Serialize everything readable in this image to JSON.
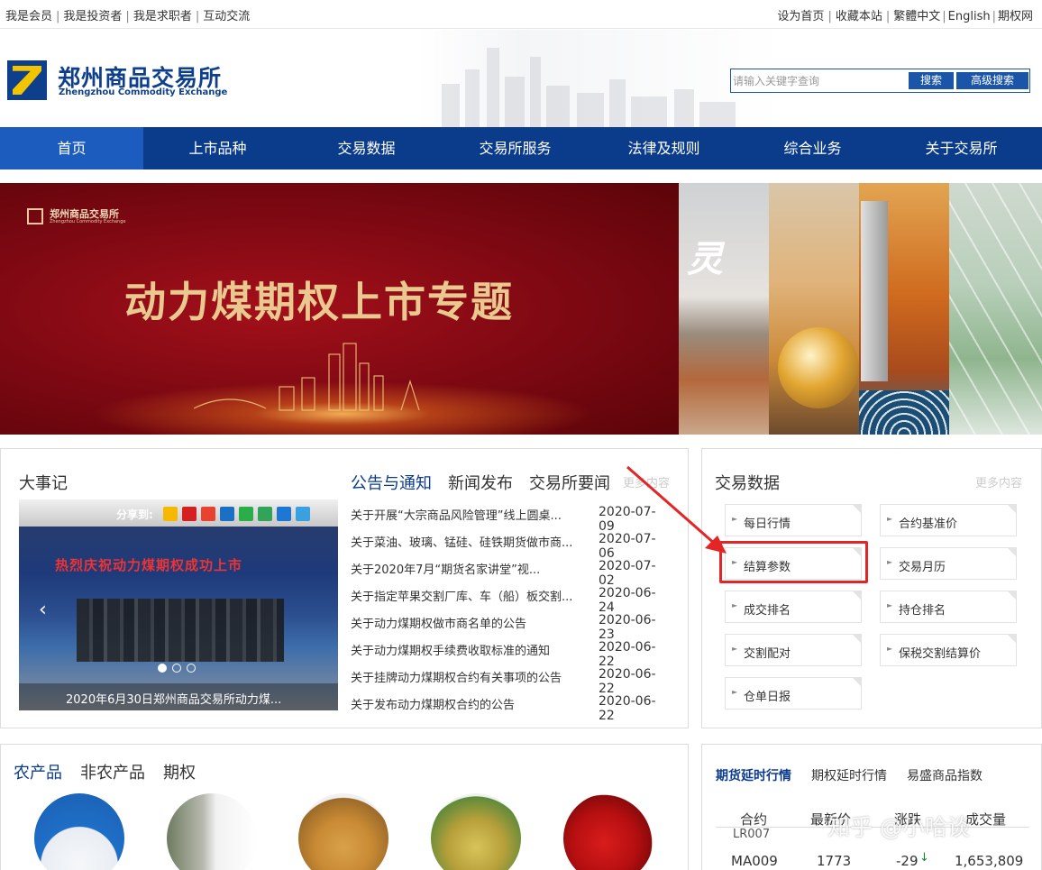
{
  "topbar": {
    "left_links": [
      "我是会员",
      "我是投资者",
      "我是求职者",
      "互动交流"
    ],
    "right_links": [
      "设为首页",
      "收藏本站",
      "繁體中文",
      "English",
      "期权网"
    ]
  },
  "header": {
    "logo_cn": "郑州商品交易所",
    "logo_en": "Zhengzhou Commodity Exchange",
    "search_placeholder": "请输入关键字查询",
    "search_button": "搜索",
    "advanced_search_button": "高级搜索"
  },
  "nav": {
    "items": [
      "首页",
      "上市品种",
      "交易数据",
      "交易所服务",
      "法律及规则",
      "综合业务",
      "关于交易所"
    ],
    "active_index": 0
  },
  "banner": {
    "mini_logo_cn": "郑州商品交易所",
    "mini_logo_en": "Zhengzhou Commodity Exchange",
    "title": "动力煤期权上市专题",
    "side_text": "灵"
  },
  "events": {
    "title": "大事记",
    "more": "更多内容",
    "share_label": "分享到:",
    "photo_banner": "热烈庆祝动力煤期权成功上市",
    "photo_caption": "2020年6月30日郑州商品交易所动力煤...",
    "tabs": [
      "公告与通知",
      "新闻发布",
      "交易所要闻"
    ],
    "active_tab": 0,
    "news": [
      {
        "title": "关于开展“大宗商品风险管理”线上圆桌...",
        "date": "2020-07-09"
      },
      {
        "title": "关于菜油、玻璃、锰硅、硅铁期货做市商...",
        "date": "2020-07-06"
      },
      {
        "title": "关于2020年7月“期货名家讲堂”视...",
        "date": "2020-07-02"
      },
      {
        "title": "关于指定苹果交割厂库、车（船）板交割...",
        "date": "2020-06-24"
      },
      {
        "title": "关于动力煤期权做市商名单的公告",
        "date": "2020-06-23"
      },
      {
        "title": "关于动力煤期权手续费收取标准的通知",
        "date": "2020-06-22"
      },
      {
        "title": "关于挂牌动力煤期权合约有关事项的公告",
        "date": "2020-06-22"
      },
      {
        "title": "关于发布动力煤期权合约的公告",
        "date": "2020-06-22"
      }
    ]
  },
  "trading": {
    "title": "交易数据",
    "more": "更多内容",
    "left_buttons": [
      "每日行情",
      "结算参数",
      "成交排名",
      "交割配对",
      "仓单日报"
    ],
    "right_buttons": [
      "合约基准价",
      "交易月历",
      "持仓排名",
      "保税交割结算价"
    ],
    "highlighted": "结算参数"
  },
  "products": {
    "tabs": [
      "农产品",
      "非农产品",
      "期权"
    ],
    "active_tab": 0
  },
  "quotes": {
    "tabs": [
      "期货延时行情",
      "期权延时行情",
      "易盛商品指数"
    ],
    "active_tab": 0,
    "headers": [
      "合约",
      "最新价",
      "涨跌",
      "成交量"
    ],
    "partial_row": "LR007",
    "rows": [
      {
        "contract": "MA009",
        "price": "1773",
        "change": "-29",
        "volume": "1,653,809"
      }
    ]
  },
  "watermark": "知乎 @小哈谈",
  "colors": {
    "nav_bg": "#0b3c8c",
    "nav_active": "#1d5cbf",
    "brand": "#0d3f8c",
    "highlight": "#e32525",
    "down": "#1a8a2a"
  }
}
